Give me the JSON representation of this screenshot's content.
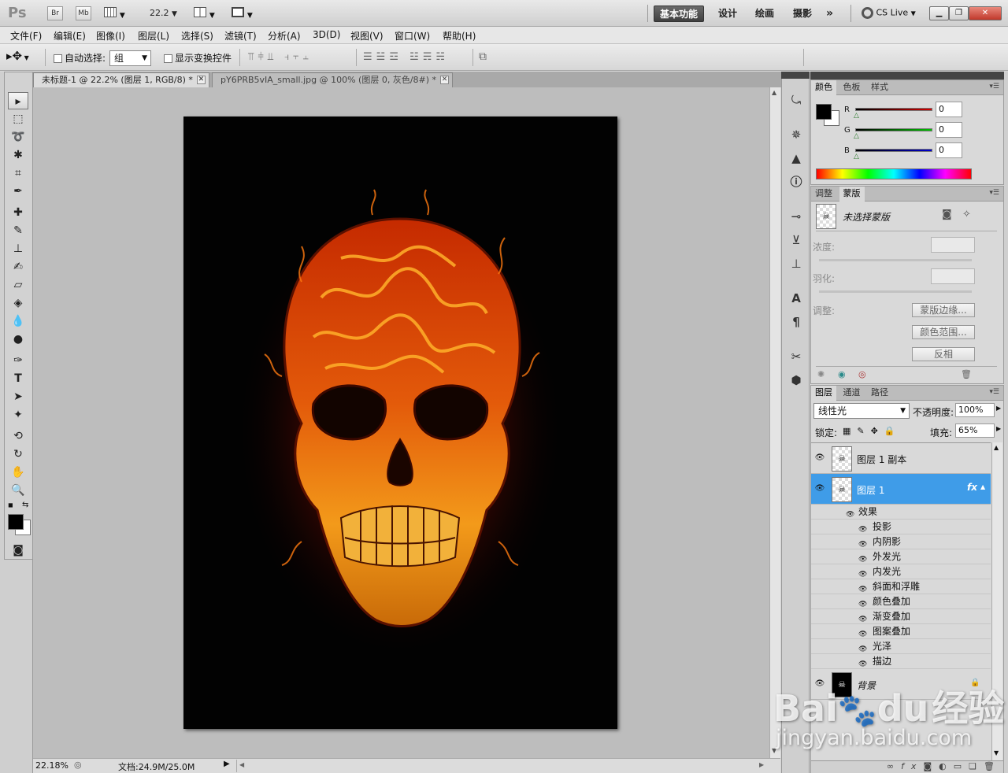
{
  "app": {
    "logo": "Ps",
    "bridge_label": "Br",
    "minibridge_label": "Mb",
    "zoom_dropdown": "22.2",
    "workspaces": [
      "基本功能",
      "设计",
      "绘画",
      "摄影"
    ],
    "more_label": "»",
    "cslive_label": "CS Live",
    "window_controls": [
      "minimize-icon",
      "restore-icon",
      "close-icon"
    ]
  },
  "menubar": [
    "文件(F)",
    "编辑(E)",
    "图像(I)",
    "图层(L)",
    "选择(S)",
    "滤镜(T)",
    "分析(A)",
    "3D(D)",
    "视图(V)",
    "窗口(W)",
    "帮助(H)"
  ],
  "options": {
    "auto_select_label": "自动选择:",
    "auto_select_value": "组",
    "show_transform_label": "显示变换控件"
  },
  "tabs": [
    {
      "label": "未标题-1 @ 22.2% (图层 1, RGB/8) *",
      "active": true
    },
    {
      "label": "pY6PRB5vIA_small.jpg @ 100% (图层 0, 灰色/8#) *",
      "active": false
    }
  ],
  "status": {
    "zoom": "22.18%",
    "doc": "文档:24.9M/25.0M"
  },
  "color_panel": {
    "tabs": [
      "颜色",
      "色板",
      "样式"
    ],
    "channels": [
      {
        "label": "R",
        "value": "0",
        "color": "#d40000"
      },
      {
        "label": "G",
        "value": "0",
        "color": "#00c000"
      },
      {
        "label": "B",
        "value": "0",
        "color": "#0000d0"
      }
    ]
  },
  "mask_panel": {
    "tabs": [
      "调整",
      "蒙版"
    ],
    "mask_title": "未选择蒙版",
    "density_label": "浓度:",
    "feather_label": "羽化:",
    "refine_label": "调整:",
    "buttons": [
      "蒙版边缘...",
      "颜色范围...",
      "反相"
    ]
  },
  "layers_panel": {
    "tabs": [
      "图层",
      "通道",
      "路径"
    ],
    "blend_mode": "线性光",
    "opacity_label": "不透明度:",
    "opacity": "100%",
    "lock_label": "锁定:",
    "fill_label": "填充:",
    "fill": "65%",
    "layers": [
      {
        "name": "图层 1 副本",
        "selected": false
      },
      {
        "name": "图层 1",
        "selected": true,
        "fx": "fx"
      }
    ],
    "effects_label": "效果",
    "effects": [
      "投影",
      "内阴影",
      "外发光",
      "内发光",
      "斜面和浮雕",
      "颜色叠加",
      "渐变叠加",
      "图案叠加",
      "光泽",
      "描边"
    ],
    "background_layer": "背景"
  },
  "watermark": {
    "logo": "Bai",
    "logo_tail": "du",
    "logo_cn": "经验",
    "url": "jingyan.baidu.com"
  }
}
